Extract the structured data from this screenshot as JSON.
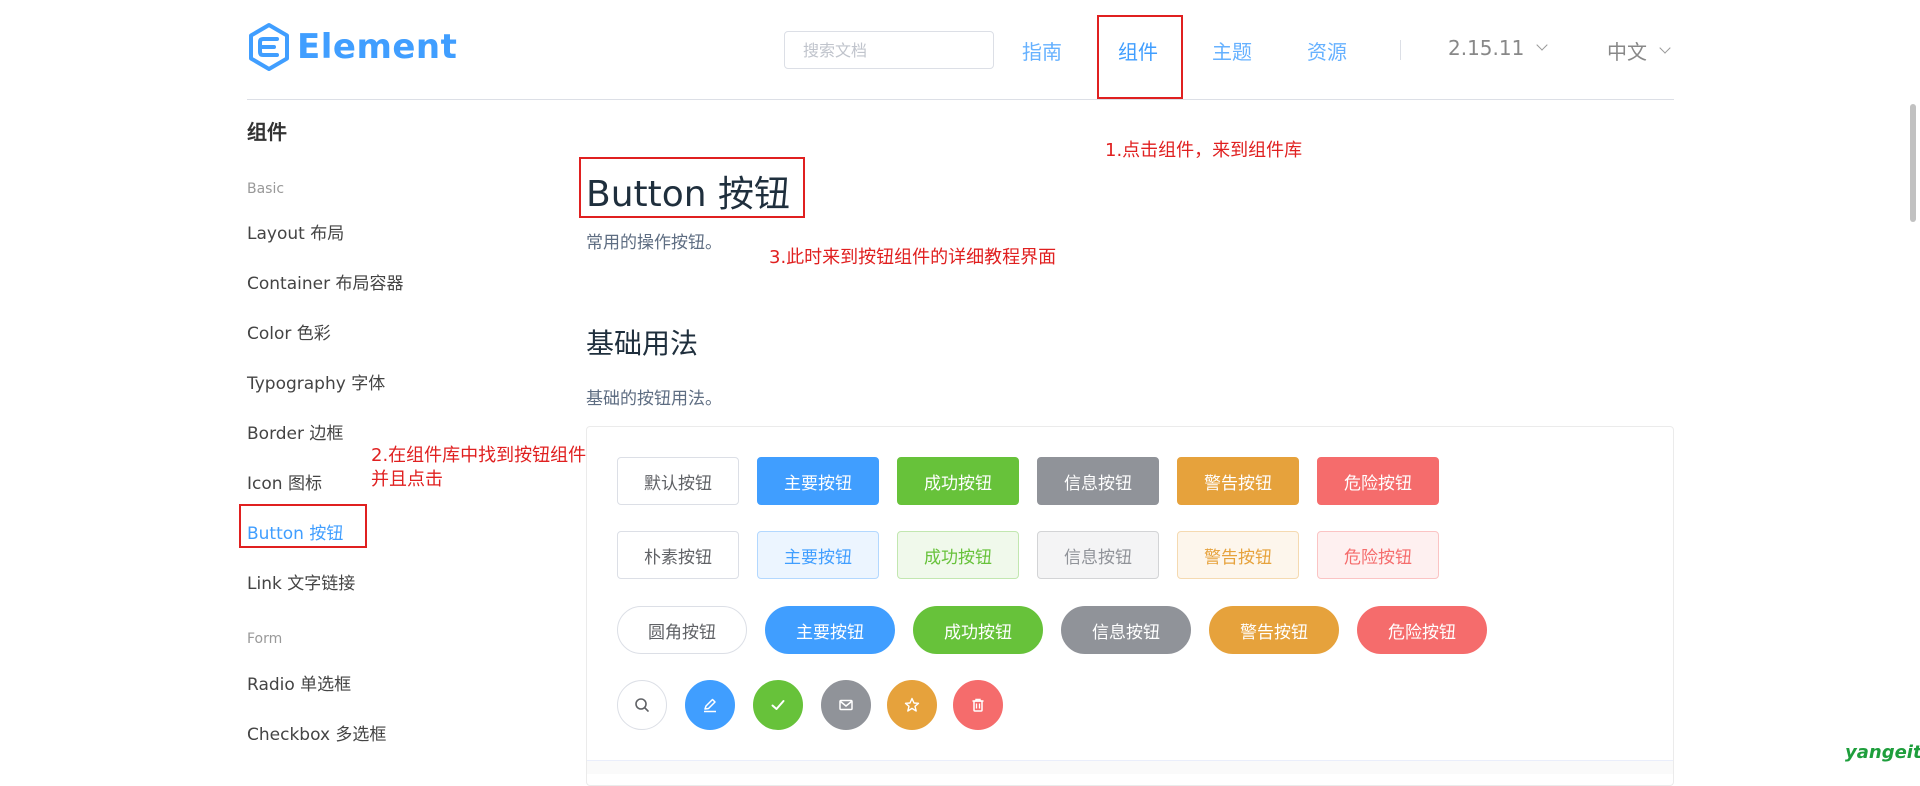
{
  "header": {
    "logo_text": "Element",
    "search_placeholder": "搜索文档",
    "nav": [
      "指南",
      "组件",
      "主题",
      "资源"
    ],
    "version": "2.15.11",
    "language": "中文"
  },
  "colors": {
    "primary": "#409EFF",
    "success": "#67C23A",
    "info": "#909399",
    "warning": "#E6A23C",
    "danger": "#F56C6C",
    "annotation": "#e02020"
  },
  "sidebar": {
    "title": "组件",
    "groups": [
      "Basic",
      "Form"
    ],
    "items": [
      "Layout 布局",
      "Container 布局容器",
      "Color 色彩",
      "Typography 字体",
      "Border 边框",
      "Icon 图标",
      "Button 按钮",
      "Link 文字链接",
      "Radio 单选框",
      "Checkbox 多选框"
    ]
  },
  "main": {
    "title": "Button 按钮",
    "desc": "常用的操作按钮。",
    "section_title": "基础用法",
    "section_desc": "基础的按钮用法。",
    "row_default": [
      "默认按钮",
      "主要按钮",
      "成功按钮",
      "信息按钮",
      "警告按钮",
      "危险按钮"
    ],
    "row_plain": [
      "朴素按钮",
      "主要按钮",
      "成功按钮",
      "信息按钮",
      "警告按钮",
      "危险按钮"
    ],
    "row_round": [
      "圆角按钮",
      "主要按钮",
      "成功按钮",
      "信息按钮",
      "警告按钮",
      "危险按钮"
    ],
    "row_circle_icons": [
      "search-icon",
      "edit-icon",
      "check-icon",
      "message-icon",
      "star-icon",
      "delete-icon"
    ]
  },
  "annotations": {
    "step1": "1.点击组件，来到组件库",
    "step2": "2.在组件库中找到按钮组件并且点击",
    "step3": "3.此时来到按钮组件的详细教程界面"
  },
  "watermark": "yangeit"
}
